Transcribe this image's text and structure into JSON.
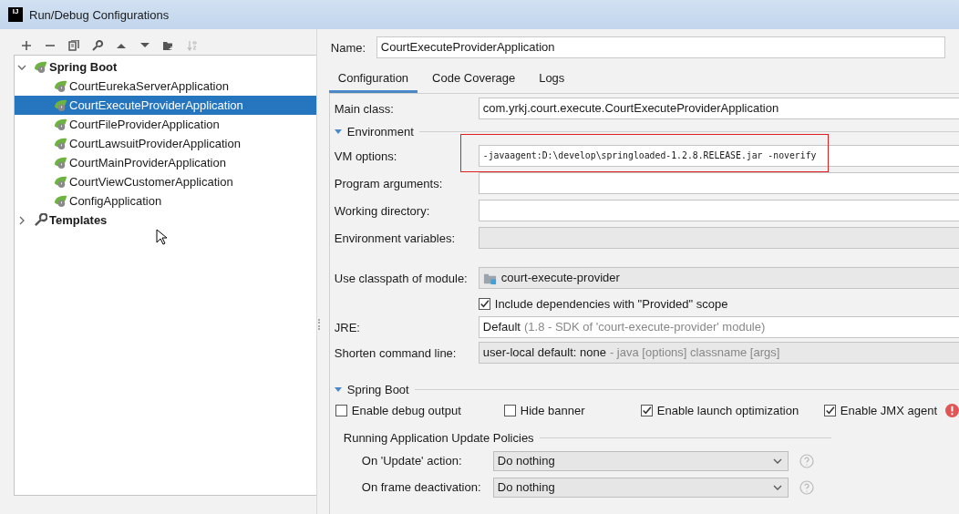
{
  "window": {
    "title": "Run/Debug Configurations",
    "logo": "IJ"
  },
  "tree": [
    {
      "label": "Spring Boot",
      "expanded": true,
      "children": [
        {
          "label": "CourtEurekaServerApplication",
          "selected": false
        },
        {
          "label": "CourtExecuteProviderApplication",
          "selected": true
        },
        {
          "label": "CourtFileProviderApplication",
          "selected": false
        },
        {
          "label": "CourtLawsuitProviderApplication",
          "selected": false
        },
        {
          "label": "CourtMainProviderApplication",
          "selected": false
        },
        {
          "label": "CourtViewCustomerApplication",
          "selected": false
        },
        {
          "label": "ConfigApplication",
          "selected": false
        }
      ]
    },
    {
      "label": "Templates",
      "expanded": false
    }
  ],
  "name": {
    "label": "Name:",
    "value": "CourtExecuteProviderApplication"
  },
  "tabs": [
    {
      "label": "Configuration",
      "selected": true
    },
    {
      "label": "Code Coverage",
      "selected": false
    },
    {
      "label": "Logs",
      "selected": false
    }
  ],
  "main_class": {
    "label": "Main class:",
    "value": "com.yrkj.court.execute.CourtExecuteProviderApplication"
  },
  "environment": {
    "title": "Environment",
    "expanded": true,
    "fields": [
      {
        "label": "VM options:",
        "value": "-javaagent:D:\\develop\\springloaded-1.2.8.RELEASE.jar -noverify",
        "kind": "mono",
        "highlighted": true
      },
      {
        "label": "Program arguments:",
        "kind": "text",
        "highlighted": false
      },
      {
        "label": "Working directory:",
        "kind": "text",
        "highlighted": false
      },
      {
        "label": "Environment variables:",
        "kind": "readonly",
        "highlighted": false
      }
    ]
  },
  "module": {
    "label": "Use classpath of module:",
    "value": "court-execute-provider"
  },
  "include_dependencies": {
    "label": "Include dependencies with \"Provided\" scope",
    "checked": true
  },
  "jre": {
    "label": "JRE:",
    "value": "Default",
    "hint": "(1.8 - SDK of 'court-execute-provider' module)"
  },
  "shorten": {
    "label": "Shorten command line:",
    "value": "user-local default: none",
    "hint": "- java [options] classname [args]"
  },
  "spring_boot": {
    "title": "Spring Boot",
    "expanded": true,
    "options": [
      {
        "label": "Enable debug output",
        "checked": false
      },
      {
        "label": "Hide banner",
        "checked": false
      },
      {
        "label": "Enable launch optimization",
        "checked": true
      },
      {
        "label": "Enable JMX agent",
        "checked": true,
        "warning": true
      }
    ]
  },
  "update_policies": {
    "title": "Running Application Update Policies",
    "rows": [
      {
        "label": "On 'Update' action:",
        "value": "Do nothing"
      },
      {
        "label": "On frame deactivation:",
        "value": "Do nothing"
      }
    ]
  }
}
